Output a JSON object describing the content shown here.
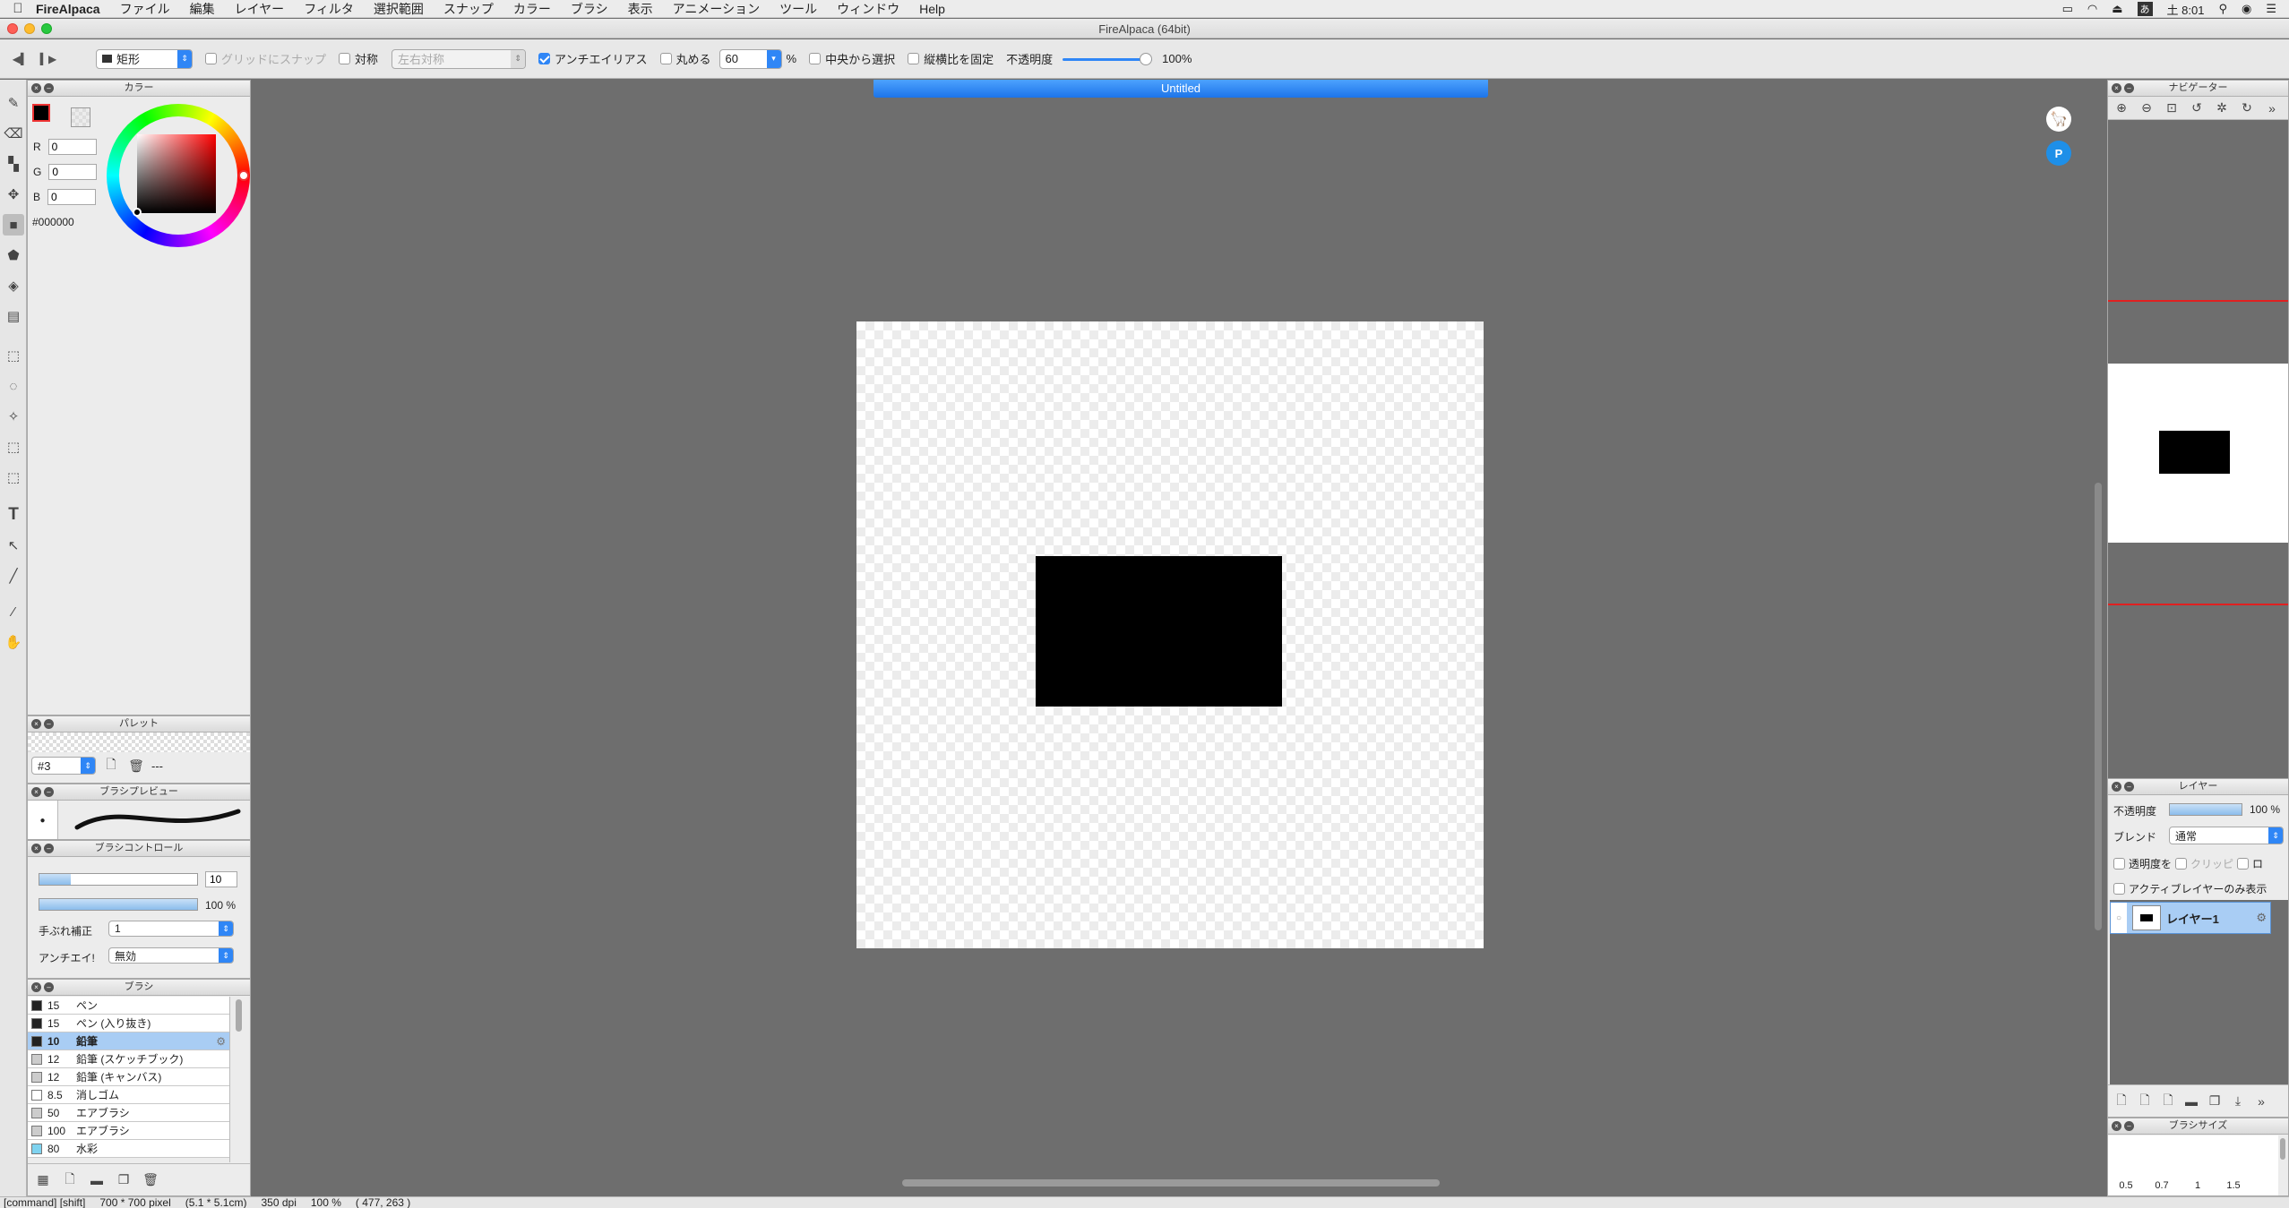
{
  "menubar": {
    "app_name": "FireAlpaca",
    "items": [
      "ファイル",
      "編集",
      "レイヤー",
      "フィルタ",
      "選択範囲",
      "スナップ",
      "カラー",
      "ブラシ",
      "表示",
      "アニメーション",
      "ツール",
      "ウィンドウ",
      "Help"
    ],
    "clock": "土 8:01"
  },
  "window": {
    "title": "FireAlpaca (64bit)"
  },
  "toolbar": {
    "shape_select": "矩形",
    "grid_snap": "グリッドにスナップ",
    "symmetry": "対称",
    "symmetry_mode": "左右対称",
    "antialias": "アンチエイリアス",
    "rounding": "丸める",
    "rounding_value": "60",
    "percent": "%",
    "from_center": "中央から選択",
    "fix_ratio": "縦横比を固定",
    "opacity_label": "不透明度",
    "opacity_value": "100%",
    "opacity_fraction": 1.0
  },
  "color_panel": {
    "title": "カラー",
    "r_label": "R",
    "r": "0",
    "g_label": "G",
    "g": "0",
    "b_label": "B",
    "b": "0",
    "hex": "#000000",
    "current_color": "#000000"
  },
  "palette_panel": {
    "title": "パレット",
    "palette_select": "#3",
    "dashes": "---"
  },
  "brush_preview_panel": {
    "title": "ブラシプレビュー"
  },
  "brush_control_panel": {
    "title": "ブラシコントロール",
    "size_value": "10",
    "opacity_value": "100 %",
    "stabilizer_label": "手ぶれ補正",
    "stabilizer_value": "1",
    "antialias_label": "アンチエイ!",
    "antialias_value": "無効"
  },
  "brush_panel": {
    "title": "ブラシ",
    "items": [
      {
        "size": "15",
        "name": "ペン",
        "color": "#222222"
      },
      {
        "size": "15",
        "name": "ペン (入り抜き)",
        "color": "#222222"
      },
      {
        "size": "10",
        "name": "鉛筆",
        "color": "#222222"
      },
      {
        "size": "12",
        "name": "鉛筆 (スケッチブック)",
        "color": "#cccccc"
      },
      {
        "size": "12",
        "name": "鉛筆 (キャンバス)",
        "color": "#cccccc"
      },
      {
        "size": "8.5",
        "name": "消しゴム",
        "color": "#ffffff"
      },
      {
        "size": "50",
        "name": "エアブラシ",
        "color": "#cccccc"
      },
      {
        "size": "100",
        "name": "エアブラシ",
        "color": "#cccccc"
      },
      {
        "size": "80",
        "name": "水彩",
        "color": "#7fd3f0"
      }
    ]
  },
  "canvas": {
    "tab_title": "Untitled"
  },
  "navigator_panel": {
    "title": "ナビゲーター"
  },
  "layer_panel": {
    "title": "レイヤー",
    "opacity_label": "不透明度",
    "opacity_value": "100 %",
    "blend_label": "ブレンド",
    "blend_value": "通常",
    "protect_alpha": "透明度を",
    "clipping": "クリッピ",
    "lock": "ロ",
    "show_active_only": "アクティブレイヤーのみ表示",
    "layer_name": "レイヤー1"
  },
  "brush_size_panel": {
    "title": "ブラシサイズ",
    "sizes": [
      "0.5",
      "0.7",
      "1",
      "1.5"
    ]
  },
  "statusbar": {
    "modifiers": "[command] [shift]",
    "dimensions": "700 * 700 pixel",
    "physical": "(5.1 * 5.1cm)",
    "dpi": "350 dpi",
    "zoom": "100 %",
    "cursor": "( 477, 263 )"
  }
}
